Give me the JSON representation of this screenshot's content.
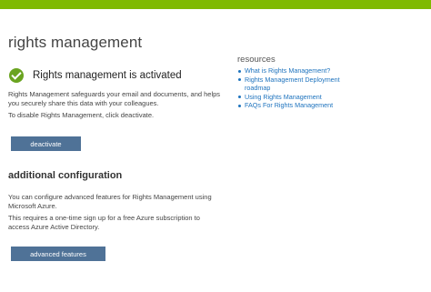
{
  "page": {
    "title": "rights management"
  },
  "status": {
    "icon": "check-circle-icon",
    "text": "Rights management is activated",
    "color": "#6aa420"
  },
  "description": {
    "line1": "Rights Management safeguards your email and documents, and helps",
    "line2": "you securely share this data with your colleagues.",
    "line3": "To disable Rights Management, click deactivate."
  },
  "deactivate_button": {
    "label": "deactivate"
  },
  "additional": {
    "heading": "additional configuration",
    "para1_line1": "You can configure advanced features for Rights Management using",
    "para1_line2": "Microsoft Azure.",
    "para2_line1": "This requires a one-time sign up for a free Azure subscription to",
    "para2_line2": "access Azure Active Directory.",
    "button_label": "advanced features"
  },
  "resources": {
    "title": "resources",
    "links": [
      {
        "line1": "What is Rights Management?",
        "line2": ""
      },
      {
        "line1": "Rights Management Deployment",
        "line2": "roadmap"
      },
      {
        "line1": "Using Rights Management",
        "line2": ""
      },
      {
        "line1": "FAQs For Rights Management",
        "line2": ""
      }
    ]
  },
  "theme": {
    "top_bar": "#7fba00",
    "button": "#4f7297",
    "link": "#1e73be"
  }
}
